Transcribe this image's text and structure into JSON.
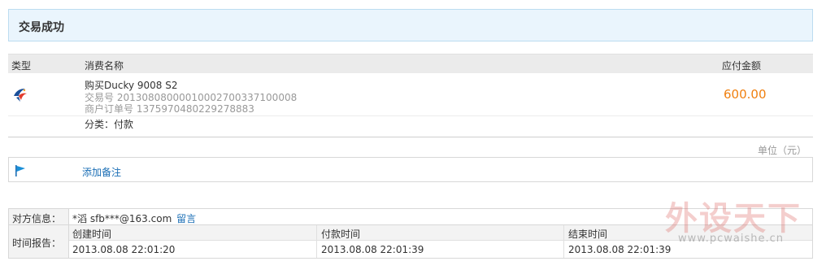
{
  "header": {
    "title": "交易成功"
  },
  "table": {
    "columns": {
      "type": "类型",
      "name": "消费名称",
      "amount": "应付金额"
    },
    "row": {
      "icon": "payment-bird-icon",
      "item_name": "购买Ducky 9008 S2",
      "tx_no": "交易号 20130808000010002700337100008",
      "order_no": "商户订单号 1375970480229278883",
      "amount": "600.00",
      "amount_color": "#f08010"
    },
    "category": "分类：付款"
  },
  "unit": "单位（元）",
  "memo": {
    "icon": "flag-icon",
    "label": "添加备注"
  },
  "counterparty": {
    "label": "对方信息：",
    "name": "*滔 sfb***@163.com",
    "message_link": "留言"
  },
  "time_report": {
    "label": "时间报告：",
    "columns": [
      "创建时间",
      "付款时间",
      "结束时间"
    ],
    "values": [
      "2013.08.08 22:01:20",
      "2013.08.08 22:01:39",
      "2013.08.08 22:01:39"
    ]
  },
  "watermark": {
    "big": "外设天下",
    "url": "www.pcwaishe.cn"
  }
}
